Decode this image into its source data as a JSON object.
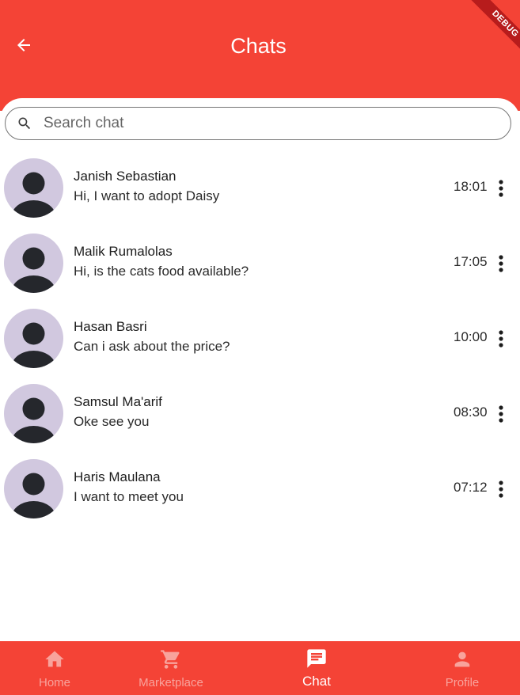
{
  "app_bar": {
    "title": "Chats",
    "back_icon": "arrow-back-icon",
    "background": "#f44336",
    "debug_label": "DEBUG"
  },
  "search": {
    "placeholder": "Search chat",
    "value": "",
    "icon": "search-icon"
  },
  "chats": [
    {
      "name": "Janish Sebastian",
      "message": "Hi, I want to adopt Daisy",
      "time": "18:01"
    },
    {
      "name": "Malik Rumalolas",
      "message": "Hi, is the cats food available?",
      "time": "17:05"
    },
    {
      "name": "Hasan Basri",
      "message": "Can i ask about the price?",
      "time": "10:00"
    },
    {
      "name": "Samsul Ma'arif",
      "message": "Oke see you",
      "time": "08:30"
    },
    {
      "name": "Haris Maulana",
      "message": "I want to meet you",
      "time": "07:12"
    }
  ],
  "bottom_nav": {
    "background": "#f44336",
    "items": [
      {
        "label": "Home",
        "icon": "home-icon",
        "active": false
      },
      {
        "label": "Marketplace",
        "icon": "shopping-cart-icon",
        "active": false
      },
      {
        "label": "Chat",
        "icon": "chat-icon",
        "active": true
      },
      {
        "label": "Profile",
        "icon": "person-icon",
        "active": false
      }
    ]
  }
}
